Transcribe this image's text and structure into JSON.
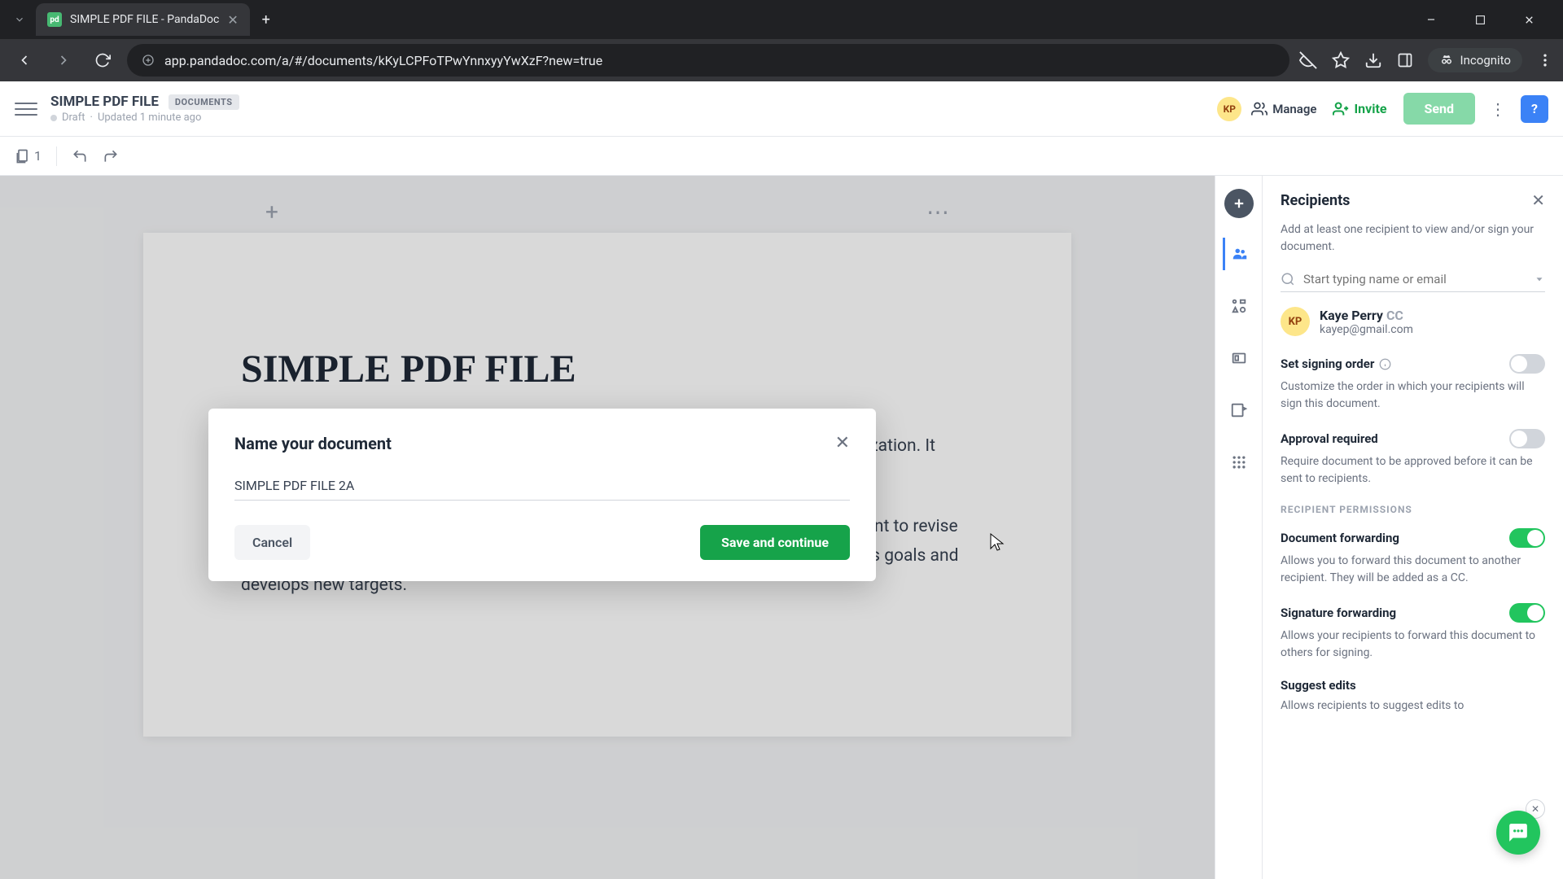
{
  "browser": {
    "tab_title": "SIMPLE PDF FILE - PandaDoc",
    "url": "app.pandadoc.com/a/#/documents/kKyLCPFoTPwYnnxyyYwXzF?new=true",
    "incognito_label": "Incognito"
  },
  "header": {
    "doc_title": "SIMPLE PDF FILE",
    "badge": "DOCUMENTS",
    "status": "Draft",
    "updated": "Updated 1 minute ago",
    "avatar_initials": "KP",
    "manage_label": "Manage",
    "invite_label": "Invite",
    "send_label": "Send"
  },
  "toolbar": {
    "page_count": "1"
  },
  "document": {
    "heading": "SIMPLE PDF FILE",
    "para1": "A mission statement is a concise description of the purpose and goals of an organization. It helps a company respond to change and make decisions that align with its vision.",
    "para2": "As a company grows, it may reach its early goals, and they'll change. So, it's important to revise mission statements as needed to reflect the business's new culture as it achieves its goals and develops new targets."
  },
  "modal": {
    "title": "Name your document",
    "input_value": "SIMPLE PDF FILE 2A",
    "cancel_label": "Cancel",
    "save_label": "Save and continue"
  },
  "panel": {
    "title": "Recipients",
    "description": "Add at least one recipient to view and/or sign your document.",
    "search_placeholder": "Start typing name or email",
    "recipient": {
      "initials": "KP",
      "name": "Kaye Perry",
      "tag": "CC",
      "email": "kayep@gmail.com"
    },
    "signing_order": {
      "label": "Set signing order",
      "desc": "Customize the order in which your recipients will sign this document."
    },
    "approval": {
      "label": "Approval required",
      "desc": "Require document to be approved before it can be sent to recipients."
    },
    "permissions_header": "RECIPIENT PERMISSIONS",
    "forwarding": {
      "label": "Document forwarding",
      "desc": "Allows you to forward this document to another recipient. They will be added as a CC."
    },
    "sig_forwarding": {
      "label": "Signature forwarding",
      "desc": "Allows your recipients to forward this document to others for signing."
    },
    "suggest": {
      "label": "Suggest edits",
      "desc": "Allows recipients to suggest edits to"
    }
  }
}
